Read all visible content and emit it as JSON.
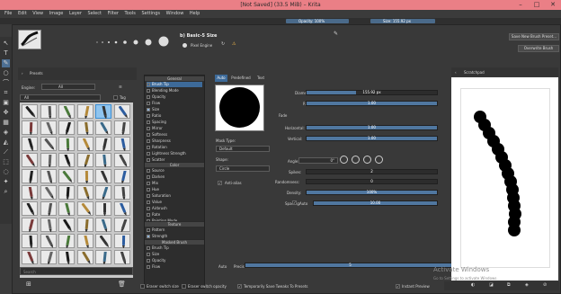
{
  "titlebar": {
    "title": "[Not Saved]  (33.5 MiB)  –  Krita",
    "minimize": "–",
    "maximize": "□",
    "close": "✕"
  },
  "menu": [
    "File",
    "Edit",
    "View",
    "Image",
    "Layer",
    "Select",
    "Filter",
    "Tools",
    "Settings",
    "Window",
    "Help"
  ],
  "toolbar": {
    "opacity_label": "Opacity: 100%",
    "size_label": "Size: 155.92 px"
  },
  "editor": {
    "preset_name": "b) Basic-5 Size",
    "engine_label": "Pixel Engine",
    "save_new_button": "Save New Brush Preset...",
    "overwrite_button": "Overwrite Brush"
  },
  "presets_panel": {
    "title": "Presets",
    "engine_label": "Engine:",
    "engine_value": "All",
    "filter_value": "All",
    "tag_label": "Tag",
    "search_placeholder": "Search"
  },
  "options_list": {
    "general_header": "General",
    "items": [
      {
        "label": "Brush Tip",
        "selected": true,
        "check": false
      },
      {
        "label": "Blending Mode",
        "check": false
      },
      {
        "label": "Opacity",
        "check": false
      },
      {
        "label": "Flow",
        "check": false
      },
      {
        "label": "Size",
        "check": true
      },
      {
        "label": "Ratio",
        "check": false
      },
      {
        "label": "Spacing",
        "check": false
      },
      {
        "label": "Mirror",
        "check": false
      },
      {
        "label": "Softness",
        "check": false
      },
      {
        "label": "Sharpness",
        "check": false
      },
      {
        "label": "Rotation",
        "check": false
      },
      {
        "label": "Lightness Strength",
        "check": false
      },
      {
        "label": "Scatter",
        "check": false
      }
    ],
    "color_header": "Color",
    "color_items": [
      {
        "label": "Source",
        "check": false
      },
      {
        "label": "Darken",
        "check": false
      },
      {
        "label": "Mix",
        "check": false
      },
      {
        "label": "Hue",
        "check": false
      },
      {
        "label": "Saturation",
        "check": false
      },
      {
        "label": "Value",
        "check": false
      },
      {
        "label": "Airbrush",
        "check": false
      },
      {
        "label": "Rate",
        "check": false
      },
      {
        "label": "Painting Mode",
        "check": false
      }
    ],
    "texture_header": "Texture",
    "texture_items": [
      {
        "label": "Pattern",
        "check": false
      },
      {
        "label": "Strength",
        "check": true
      }
    ],
    "masked_header": "Masked Brush",
    "masked_items": [
      {
        "label": "Brush Tip",
        "check": false
      },
      {
        "label": "Size",
        "check": false
      },
      {
        "label": "Opacity",
        "check": false
      },
      {
        "label": "Flow",
        "check": false
      }
    ]
  },
  "tabs": [
    "Auto",
    "Predefined",
    "Text"
  ],
  "brush_tip": {
    "diameter_label": "Diameter:",
    "diameter_value": "155.92 px",
    "ratio_label": "Ratio:",
    "ratio_value": "1.00",
    "fade_label": "Fade",
    "horizontal_label": "Horizontal:",
    "horizontal_value": "1.00",
    "vertical_label": "Vertical:",
    "vertical_value": "1.00",
    "mask_type_label": "Mask Type:",
    "mask_type_value": "Default",
    "shape_label": "Shape:",
    "shape_value": "Circle",
    "antialias_label": "Anti-alias",
    "angle_label": "Angle:",
    "angle_value": "0°",
    "spikes_label": "Spikes:",
    "spikes_value": "2",
    "randomness_label": "Randomness:",
    "randomness_value": "0",
    "density_label": "Density:",
    "density_value": "100%",
    "spacing_label": "Spacing:",
    "spacing_auto": "Auto",
    "spacing_value": "10.00",
    "precision_auto": "Auto",
    "precision_label": "Precision:",
    "precision_value": "5"
  },
  "scratchpad": {
    "title": "Scratchpad"
  },
  "bottom": {
    "eraser_size": "Eraser switch size",
    "eraser_opacity": "Eraser switch opacity",
    "temp_save": "Temporarily Save Tweaks To Presets",
    "instant_preview": "Instant Preview"
  },
  "watermark": {
    "line1": "Activate Windows",
    "line2": "Go to Settings to activate Windows."
  }
}
